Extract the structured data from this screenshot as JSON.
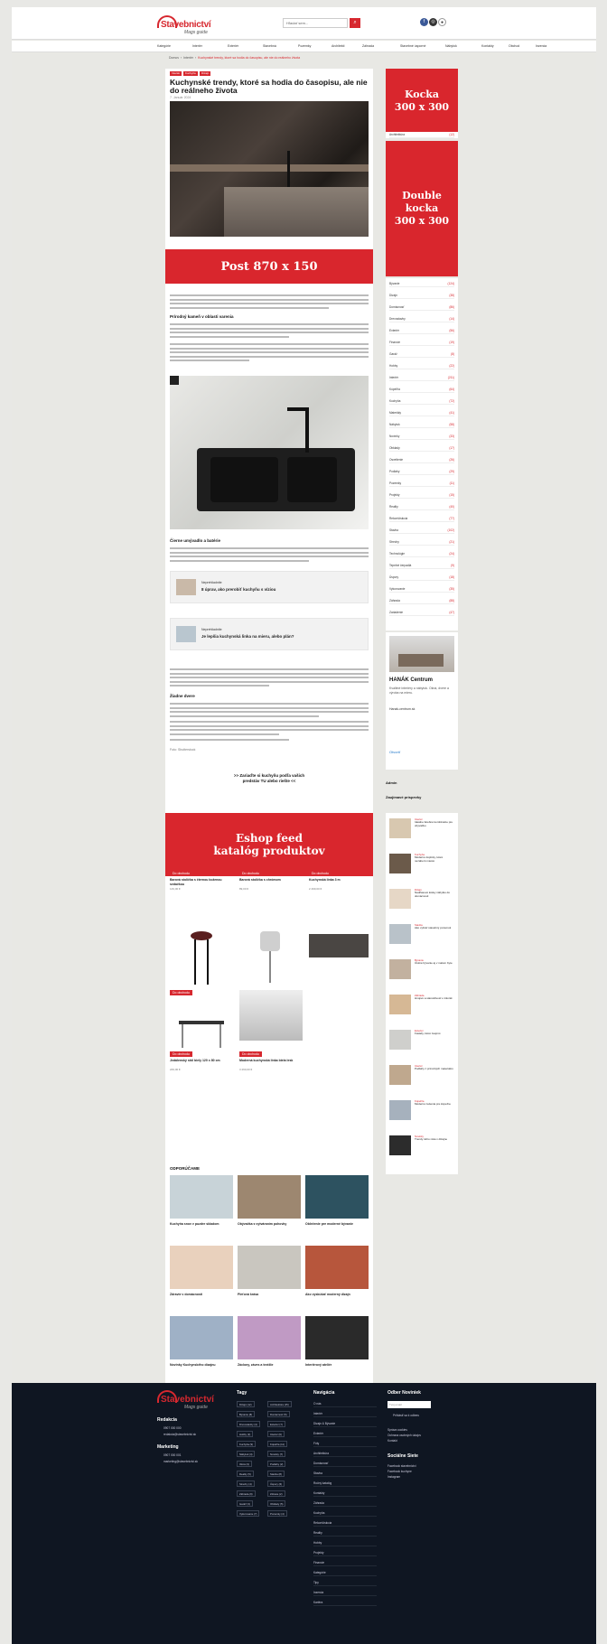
{
  "header": {
    "logo_text": "Stavebnictví",
    "logo_sub": "Mags guide",
    "search_placeholder": "Hľadať sem...",
    "search_icon": "search-icon",
    "social": [
      "facebook-icon",
      "instagram-icon",
      "user-icon"
    ]
  },
  "nav": [
    "Kategórie",
    "Interiér",
    "Exteriér",
    "Stavebná",
    "Pozemky",
    "Architekti",
    "Záhrada",
    "Stavebné úsporné",
    "Nábytok",
    "Kontakty",
    "Obchod",
    "Inzercia"
  ],
  "breadcrumb": {
    "home": "Domov",
    "section": "Interiér",
    "current": "Kuchynské trendy, ktoré sa hodia do časopisu, ale nie do reálneho života"
  },
  "article": {
    "tags": [
      "Interiér",
      "Kuchyňa",
      "Dizajn"
    ],
    "title": "Kuchynské trendy, ktoré sa hodia do časopisu, ale nie do reálneho života",
    "meta": "7. Január 2024",
    "ad_post": "Post 870 x 150",
    "h_sub1": "Prírodný kameň v oblasti varenia",
    "h_sub2": "Čierne umývadlo a batérie",
    "h_sub3": "Žiadne dvere",
    "related1_label": "Neprehliadnite",
    "related1_title": "8 úprav, ako prerobiť kuchyňu s víziou",
    "related2_label": "Neprehliadnite",
    "related2_title": "Je lepšia kuchynská linka na mieru, alebo plán?",
    "credit_label": "Foto: Shutterstock",
    "cta1": ">> Zariaďte si kuchyňu podľa vašich",
    "cta2": "predstáv TU alebo riešte <<",
    "ad_feed1": "Eshop feed",
    "ad_feed2": "katalóg produktov"
  },
  "products": [
    {
      "badge": "Do obchodu",
      "name": "Barová stolička s čiernou koženou sedačkou",
      "price": "149,00 €"
    },
    {
      "badge": "Do obchodu",
      "name": "Barová stolička s chrómom",
      "price": "89,00 €"
    },
    {
      "badge": "Do obchodu",
      "name": "Kuchynská linka 3 m",
      "price": "2 499,00 €"
    },
    {
      "badge": "Do obchodu",
      "name": "Jedálenský stôl biely 120 x 80 cm",
      "price": "249,00 €"
    },
    {
      "badge": "Do obchodu",
      "name": "Moderná kuchynská linka biela lesk",
      "price": "3 290,00 €"
    }
  ],
  "recommend_title": "ODPORÚČAME",
  "recommend": [
    "Kuchyňa snov v puzdre skladom",
    "Obývačka s vytváraním pohovky",
    "Oblečenie pre moderné bývanie",
    "Zdravie v domácnosti",
    "Pleťová krása",
    "Ako vyskúšať moderný dizajn",
    "Novinky Kuchynského dizajnu",
    "Záclony, záves a textílie",
    "Interiérový ateliér"
  ],
  "sidebar": {
    "ad1_l1": "Kocka",
    "ad1_l2": "300 x 300",
    "ad2_l1": "Double",
    "ad2_l2": "kocka",
    "ad2_l3": "300 x 300",
    "cats": [
      [
        "Architektúra",
        "(12)"
      ],
      [
        "Bývanie",
        "(124)"
      ],
      [
        "Dizajn",
        "(38)"
      ],
      [
        "Domácnosť",
        "(86)"
      ],
      [
        "Drevostavby",
        "(14)"
      ],
      [
        "Exteriér",
        "(56)"
      ],
      [
        "Financie",
        "(19)"
      ],
      [
        "Garáž",
        "(8)"
      ],
      [
        "Hobby",
        "(22)"
      ],
      [
        "Interiér",
        "(211)"
      ],
      [
        "Kúpeľňa",
        "(64)"
      ],
      [
        "Kuchyňa",
        "(72)"
      ],
      [
        "Materiály",
        "(41)"
      ],
      [
        "Nábytok",
        "(58)"
      ],
      [
        "Novinky",
        "(33)"
      ],
      [
        "Obklady",
        "(17)"
      ],
      [
        "Osvetlenie",
        "(26)"
      ],
      [
        "Podlahy",
        "(29)"
      ],
      [
        "Pozemky",
        "(11)"
      ],
      [
        "Projekty",
        "(15)"
      ],
      [
        "Reality",
        "(40)"
      ],
      [
        "Rekonštrukcia",
        "(77)"
      ],
      [
        "Stavba",
        "(102)"
      ],
      [
        "Strechy",
        "(21)"
      ],
      [
        "Technológie",
        "(24)"
      ],
      [
        "Tepelné čerpadlá",
        "(9)"
      ],
      [
        "Úspory",
        "(18)"
      ],
      [
        "Vykurovanie",
        "(35)"
      ],
      [
        "Záhrada",
        "(88)"
      ],
      [
        "Zariadenie",
        "(47)"
      ]
    ],
    "hanak_title": "HANÁK Centrum",
    "hanak_text": "Kvalitné interiéry a nábytok. Okná, dvere a výroba na mieru.",
    "hanak_link": "Hanak-centrum.sk",
    "hanak_more": "Otvoriť",
    "admin": "Admin",
    "zaj_title": "Zaujímavé príspevky",
    "zaj": [
      [
        "Interiér",
        "Ideálne farebné kombinácie pre obývačku"
      ],
      [
        "Kuchyňa",
        "Moderné doplnky, ktoré nezaberú miesto"
      ],
      [
        "Dizajn",
        "Nadčasové kúsky nábytku do domácnosti"
      ],
      [
        "Stavba",
        "Ako vybrať stavebný pozemok"
      ],
      [
        "Bývanie",
        "Útulné bývanie aj v malom byte"
      ],
      [
        "Záhrada",
        "Hnojivo a starostlivosť o trávnik"
      ],
      [
        "Exteriér",
        "Fasády, ktoré zaujmú"
      ],
      [
        "Interiér",
        "Podlahy z prírodných materiálov"
      ],
      [
        "Kúpeľňa",
        "Moderné riešenia pre kúpeľne"
      ],
      [
        "Novinky",
        "Trendy tohto roka v dizajne"
      ]
    ]
  },
  "footer": {
    "redakcia": "Redakcia",
    "red_phone": "0907 000 000",
    "red_mail": "redakcia@stavebnictvi.sk",
    "marketing": "Marketing",
    "mk_phone": "0907 000 001",
    "mk_mail": "marketing@stavebnictvi.sk",
    "tags_title": "Tagy",
    "tags": [
      "Dizajn (12)",
      "Architektúra (15)",
      "Bývanie (8)",
      "Domácnosť (5)",
      "Drevostavby (4)",
      "Exteriér (7)",
      "Hobby (3)",
      "Interiér (6)",
      "Kuchyňa (9)",
      "Kúpeľňa (11)",
      "Nábytok (4)",
      "Novinky (7)",
      "Okná (3)",
      "Podlahy (2)",
      "Reality (5)",
      "Stavba (8)",
      "Strechy (4)",
      "Úspory (6)",
      "Záhrada (9)",
      "Zdravie (2)",
      "Garáž (3)",
      "Obklady (5)",
      "Vykurovanie (7)",
      "Pozemky (4)"
    ],
    "nav_title": "Navigácia",
    "nav": [
      "O nás",
      "Interiér",
      "Dizajn & Bývanie",
      "Exteriér",
      "Fóty",
      "Architektúra",
      "Domácnosť",
      "Stavba",
      "Ročný katalóg",
      "Kontakty",
      "Záhrada",
      "Kuchyňa",
      "Rekonštrukcia",
      "Reality",
      "Hobby",
      "Projekty",
      "Financie",
      "Kategórie",
      "Tipy",
      "Inzercia",
      "Kariéra"
    ],
    "news_title": "Odber Noviniek",
    "news_placeholder": "Tvoj email",
    "news_btn": "Prihlásiť sa k odberu",
    "links": [
      "Správa cookies",
      "Ochrana osobných údajov",
      "Kontakt"
    ],
    "social_title": "Sociálne Siete",
    "social": [
      "Facebook stavebnictvi",
      "Facebook kuchyne",
      "Instagram"
    ]
  }
}
